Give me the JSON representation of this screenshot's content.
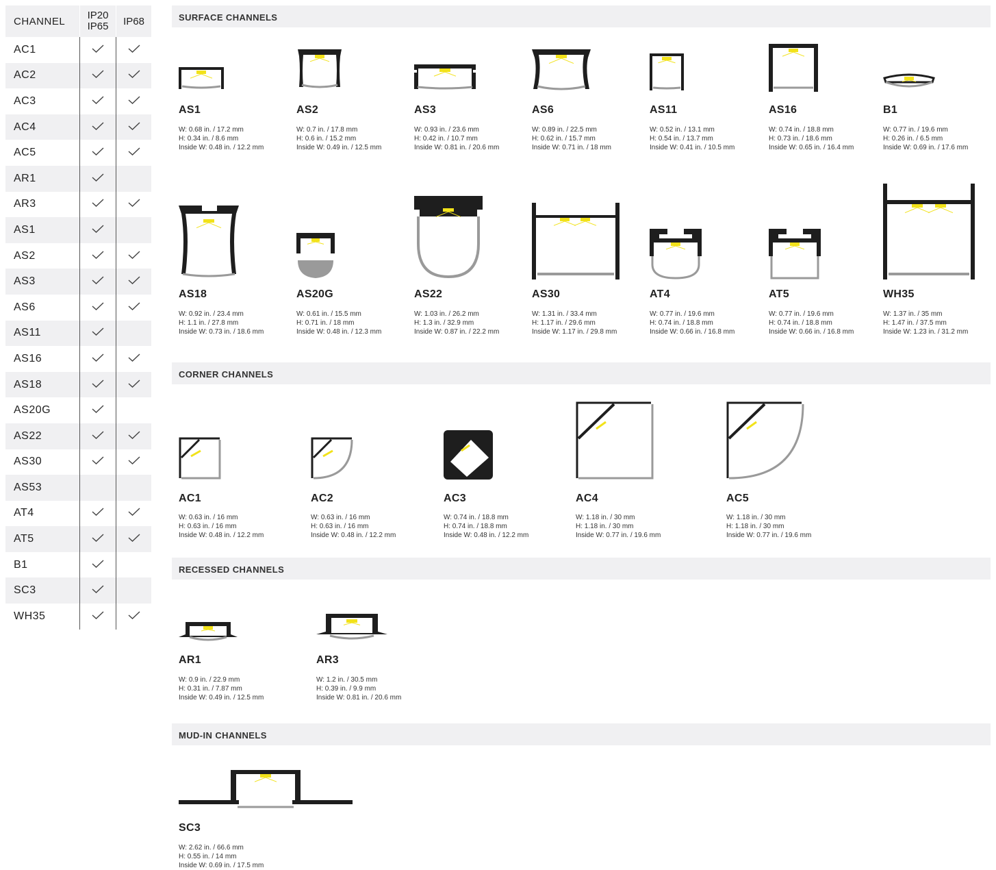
{
  "table": {
    "headers": {
      "channel": "CHANNEL",
      "ip20": "IP20",
      "ip65": "IP65",
      "ip68": "IP68"
    },
    "rows": [
      {
        "name": "AC1",
        "ip20": true,
        "ip68": true
      },
      {
        "name": "AC2",
        "ip20": true,
        "ip68": true
      },
      {
        "name": "AC3",
        "ip20": true,
        "ip68": true
      },
      {
        "name": "AC4",
        "ip20": true,
        "ip68": true
      },
      {
        "name": "AC5",
        "ip20": true,
        "ip68": true
      },
      {
        "name": "AR1",
        "ip20": true,
        "ip68": false
      },
      {
        "name": "AR3",
        "ip20": true,
        "ip68": true
      },
      {
        "name": "AS1",
        "ip20": true,
        "ip68": false
      },
      {
        "name": "AS2",
        "ip20": true,
        "ip68": true
      },
      {
        "name": "AS3",
        "ip20": true,
        "ip68": true
      },
      {
        "name": "AS6",
        "ip20": true,
        "ip68": true
      },
      {
        "name": "AS11",
        "ip20": true,
        "ip68": false
      },
      {
        "name": "AS16",
        "ip20": true,
        "ip68": true
      },
      {
        "name": "AS18",
        "ip20": true,
        "ip68": true
      },
      {
        "name": "AS20G",
        "ip20": true,
        "ip68": false
      },
      {
        "name": "AS22",
        "ip20": true,
        "ip68": true
      },
      {
        "name": "AS30",
        "ip20": true,
        "ip68": true
      },
      {
        "name": "AS53",
        "ip20": false,
        "ip68": false
      },
      {
        "name": "AT4",
        "ip20": true,
        "ip68": true
      },
      {
        "name": "AT5",
        "ip20": true,
        "ip68": true
      },
      {
        "name": "B1",
        "ip20": true,
        "ip68": false
      },
      {
        "name": "SC3",
        "ip20": true,
        "ip68": false
      },
      {
        "name": "WH35",
        "ip20": true,
        "ip68": true
      }
    ]
  },
  "sections": {
    "surface": {
      "title": "SURFACE CHANNELS",
      "items": [
        {
          "name": "AS1",
          "w": "W: 0.68 in. / 17.2 mm",
          "h": "H: 0.34 in. / 8.6 mm",
          "iw": "Inside W: 0.48 in. / 12.2 mm",
          "icon": "as1-profile-icon"
        },
        {
          "name": "AS2",
          "w": "W: 0.7 in. / 17.8 mm",
          "h": "H: 0.6 in. / 15.2 mm",
          "iw": "Inside W: 0.49 in. / 12.5 mm",
          "icon": "as2-profile-icon"
        },
        {
          "name": "AS3",
          "w": "W: 0.93 in. / 23.6 mm",
          "h": "H: 0.42 in. / 10.7 mm",
          "iw": "Inside W: 0.81 in. / 20.6 mm",
          "icon": "as3-profile-icon"
        },
        {
          "name": "AS6",
          "w": "W: 0.89 in. / 22.5 mm",
          "h": "H: 0.62 in. / 15.7 mm",
          "iw": "Inside W: 0.71 in. / 18 mm",
          "icon": "as6-profile-icon"
        },
        {
          "name": "AS11",
          "w": "W: 0.52 in. / 13.1 mm",
          "h": "H: 0.54 in. / 13.7 mm",
          "iw": "Inside W: 0.41 in. / 10.5 mm",
          "icon": "as11-profile-icon"
        },
        {
          "name": "AS16",
          "w": "W: 0.74 in. / 18.8 mm",
          "h": "H: 0.73 in. / 18.6 mm",
          "iw": "Inside W: 0.65 in. / 16.4 mm",
          "icon": "as16-profile-icon"
        },
        {
          "name": "B1",
          "w": "W: 0.77 in. / 19.6 mm",
          "h": "H: 0.26 in. / 6.5 mm",
          "iw": "Inside W: 0.69 in. / 17.6 mm",
          "icon": "b1-profile-icon"
        },
        {
          "name": "AS18",
          "w": "W: 0.92 in. / 23.4 mm",
          "h": "H: 1.1 in. / 27.8 mm",
          "iw": "Inside W: 0.73 in. / 18.6 mm",
          "icon": "as18-profile-icon"
        },
        {
          "name": "AS20G",
          "w": "W: 0.61 in. / 15.5 mm",
          "h": "H: 0.71 in. / 18 mm",
          "iw": "Inside W: 0.48 in. / 12.3 mm",
          "icon": "as20g-profile-icon"
        },
        {
          "name": "AS22",
          "w": "W: 1.03 in. / 26.2 mm",
          "h": "H: 1.3 in. / 32.9 mm",
          "iw": "Inside W: 0.87 in. / 22.2 mm",
          "icon": "as22-profile-icon"
        },
        {
          "name": "AS30",
          "w": "W: 1.31 in. / 33.4 mm",
          "h": "H: 1.17 in. / 29.6 mm",
          "iw": "Inside W: 1.17 in. / 29.8 mm",
          "icon": "as30-profile-icon"
        },
        {
          "name": "AT4",
          "w": "W: 0.77 in. / 19.6 mm",
          "h": "H: 0.74 in. / 18.8 mm",
          "iw": "Inside W: 0.66 in. / 16.8 mm",
          "icon": "at4-profile-icon"
        },
        {
          "name": "AT5",
          "w": "W: 0.77 in. / 19.6 mm",
          "h": "H: 0.74 in. / 18.8 mm",
          "iw": "Inside W: 0.66 in. / 16.8 mm",
          "icon": "at5-profile-icon"
        },
        {
          "name": "WH35",
          "w": "W: 1.37 in. / 35 mm",
          "h": "H: 1.47 in. / 37.5 mm",
          "iw": "Inside W: 1.23 in. / 31.2 mm",
          "icon": "wh35-profile-icon"
        }
      ]
    },
    "corner": {
      "title": "CORNER CHANNELS",
      "items": [
        {
          "name": "AC1",
          "w": "W: 0.63 in. / 16 mm",
          "h": "H: 0.63 in. / 16 mm",
          "iw": "Inside W: 0.48 in. / 12.2 mm",
          "icon": "ac1-profile-icon"
        },
        {
          "name": "AC2",
          "w": "W: 0.63 in. / 16 mm",
          "h": "H: 0.63 in. / 16 mm",
          "iw": "Inside W: 0.48 in. / 12.2 mm",
          "icon": "ac2-profile-icon"
        },
        {
          "name": "AC3",
          "w": "W: 0.74 in. / 18.8 mm",
          "h": "H: 0.74 in. / 18.8 mm",
          "iw": "Inside W: 0.48 in. / 12.2 mm",
          "icon": "ac3-profile-icon"
        },
        {
          "name": "AC4",
          "w": "W: 1.18 in. / 30 mm",
          "h": "H: 1.18 in. / 30 mm",
          "iw": "Inside W: 0.77 in. / 19.6 mm",
          "icon": "ac4-profile-icon"
        },
        {
          "name": "AC5",
          "w": "W: 1.18 in. / 30 mm",
          "h": "H: 1.18 in. / 30 mm",
          "iw": "Inside W: 0.77 in. / 19.6 mm",
          "icon": "ac5-profile-icon"
        }
      ]
    },
    "recessed": {
      "title": "RECESSED CHANNELS",
      "items": [
        {
          "name": "AR1",
          "w": "W: 0.9 in. / 22.9 mm",
          "h": "H: 0.31 in. / 7.87 mm",
          "iw": "Inside W: 0.49 in. / 12.5 mm",
          "icon": "ar1-profile-icon"
        },
        {
          "name": "AR3",
          "w": "W: 1.2 in. / 30.5 mm",
          "h": "H: 0.39 in. / 9.9 mm",
          "iw": "Inside W: 0.81 in. / 20.6 mm",
          "icon": "ar3-profile-icon"
        }
      ]
    },
    "mudin": {
      "title": "MUD-IN CHANNELS",
      "items": [
        {
          "name": "SC3",
          "w": "W: 2.62 in. / 66.6 mm",
          "h": "H: 0.55 in. / 14 mm",
          "iw": "Inside W: 0.69 in. / 17.5 mm",
          "icon": "sc3-profile-icon"
        }
      ]
    }
  },
  "colors": {
    "profile": "#1e1e1e",
    "diffuser": "#9a9a9a",
    "led": "#f2e21a",
    "bar": "#f0f0f2"
  }
}
